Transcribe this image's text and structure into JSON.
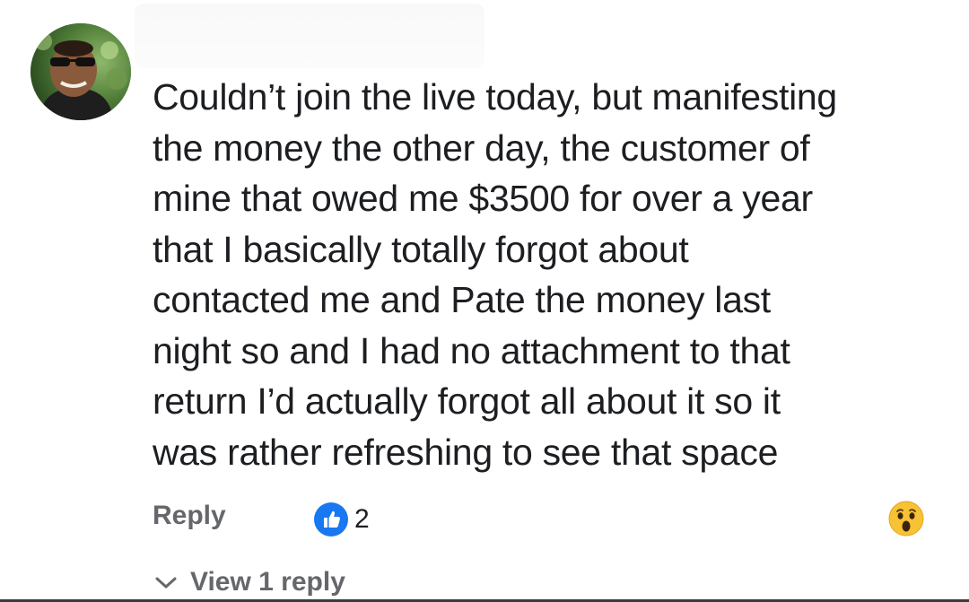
{
  "comment": {
    "text_lines": [
      "Couldn’t join the live today, but manifesting",
      "the money the other day, the customer of",
      "mine that owed me $3500 for over a year",
      "that I basically totally forgot about",
      "contacted me and Pate the money last",
      "night so and I had no attachment to that",
      "return I’d actually forgot all about it so it",
      "was rather refreshing to see that space"
    ]
  },
  "actions": {
    "reply_label": "Reply",
    "like_count": "2",
    "reaction_icon": "wow-emoji-icon",
    "like_icon": "thumbs-up-icon"
  },
  "replies": {
    "view_label": "View 1 reply"
  },
  "colors": {
    "text": "#1c1e21",
    "secondary": "#65676b",
    "like_blue": "#1877f2",
    "wow_yellow": "#f7c234"
  }
}
